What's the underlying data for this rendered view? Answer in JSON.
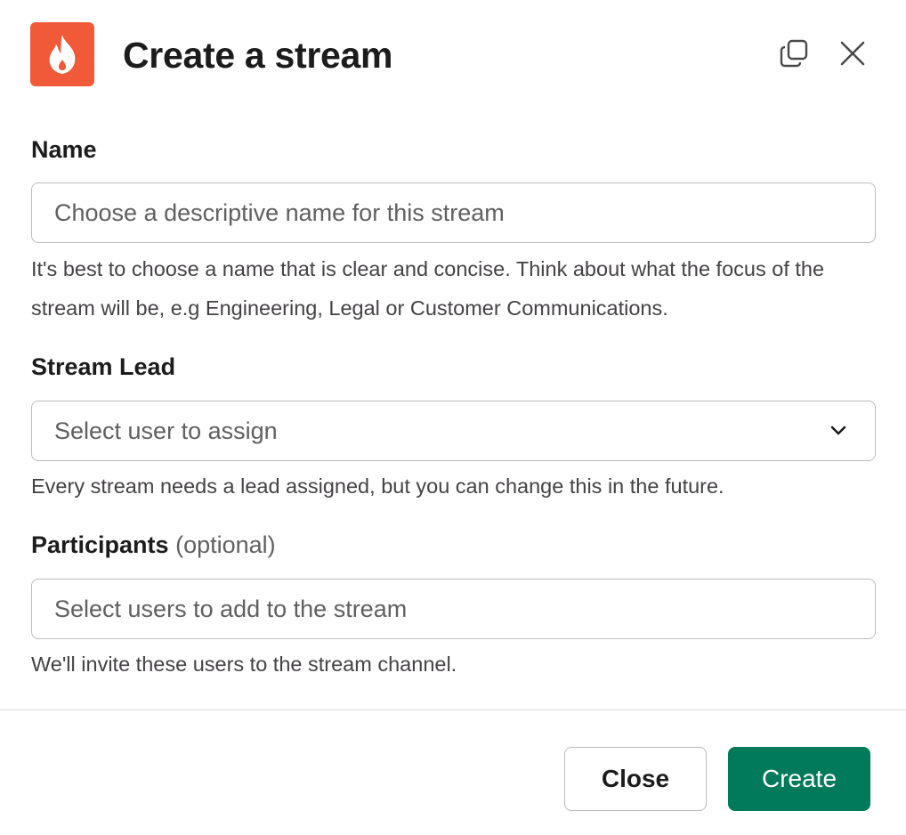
{
  "colors": {
    "app_icon_bg": "#f05a38",
    "primary_button": "#007a5a",
    "text": "#1d1c1d",
    "muted_text": "#616061",
    "border": "#bdbcbd"
  },
  "header": {
    "app_icon": "flame-icon",
    "title": "Create a stream",
    "copy_icon": "copy-icon",
    "close_icon": "close-icon"
  },
  "form": {
    "name": {
      "label": "Name",
      "placeholder": "Choose a descriptive name for this stream",
      "help": "It's best to choose a name that is clear and concise. Think about what the focus of the stream will be, e.g Engineering, Legal or Customer Communications."
    },
    "stream_lead": {
      "label": "Stream Lead",
      "placeholder": "Select user to assign",
      "icon": "chevron-down-icon",
      "help": "Every stream needs a lead assigned, but you can change this in the future."
    },
    "participants": {
      "label": "Participants",
      "optional": "(optional)",
      "placeholder": "Select users to add to the stream",
      "help": "We'll invite these users to the stream channel."
    }
  },
  "footer": {
    "close_label": "Close",
    "create_label": "Create"
  }
}
